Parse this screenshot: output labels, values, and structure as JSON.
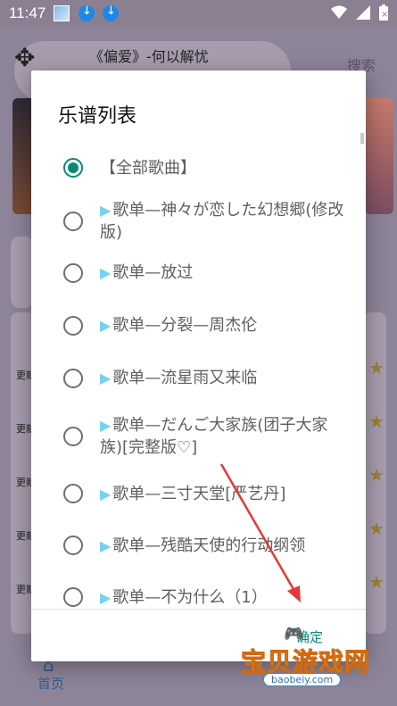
{
  "status_bar": {
    "time": "11:47",
    "icons": [
      "image-icon",
      "download-icon",
      "download-icon",
      "wifi-icon",
      "signal-icon",
      "battery-icon"
    ]
  },
  "background": {
    "song_title": "《偏爱》-何以解忧",
    "search_label": "搜索",
    "update_label": "更新",
    "nav_home": "首页"
  },
  "dialog": {
    "title": "乐谱列表",
    "confirm_label": "确定",
    "items": [
      {
        "label": "【全部歌曲】",
        "checked": true,
        "prefix": ""
      },
      {
        "label": "歌单—神々が恋した幻想郷(修改版)",
        "checked": false,
        "prefix": "▶"
      },
      {
        "label": "歌单—放过",
        "checked": false,
        "prefix": "▶"
      },
      {
        "label": "歌单—分裂—周杰伦",
        "checked": false,
        "prefix": "▶"
      },
      {
        "label": "歌单—流星雨又来临",
        "checked": false,
        "prefix": "▶"
      },
      {
        "label": "歌单—だんご大家族(团子大家族)[完整版♡]",
        "checked": false,
        "prefix": "▶"
      },
      {
        "label": "歌单—三寸天堂[严艺丹]",
        "checked": false,
        "prefix": "▶"
      },
      {
        "label": "歌单—残酷天使的行动纲领",
        "checked": false,
        "prefix": "▶"
      },
      {
        "label": "歌单—不为什么（1）",
        "checked": false,
        "prefix": "▶"
      }
    ]
  },
  "watermark": {
    "brand": "宝贝游戏网",
    "site": "baobeiy.com"
  },
  "colors": {
    "accent": "#0a8a74",
    "triangle": "#72d3f0",
    "scrim": "#8b7f96"
  }
}
